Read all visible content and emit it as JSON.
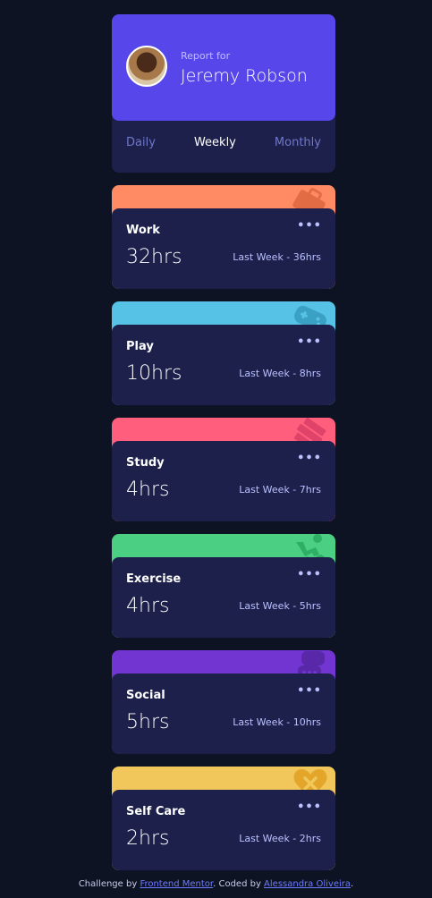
{
  "profile": {
    "report_for": "Report for",
    "name": "Jeremy Robson",
    "periods": [
      "Daily",
      "Weekly",
      "Monthly"
    ],
    "active_period": "Weekly"
  },
  "cards": [
    {
      "title": "Work",
      "hours": "32hrs",
      "last": "Last Week - 36hrs",
      "color": "#ff8b64",
      "icon": "briefcase-icon"
    },
    {
      "title": "Play",
      "hours": "10hrs",
      "last": "Last Week - 8hrs",
      "color": "#55c2e6",
      "icon": "gamepad-icon"
    },
    {
      "title": "Study",
      "hours": "4hrs",
      "last": "Last Week - 7hrs",
      "color": "#ff5e7d",
      "icon": "books-icon"
    },
    {
      "title": "Exercise",
      "hours": "4hrs",
      "last": "Last Week - 5hrs",
      "color": "#4bcf82",
      "icon": "runner-icon"
    },
    {
      "title": "Social",
      "hours": "5hrs",
      "last": "Last Week - 10hrs",
      "color": "#7335d2",
      "icon": "chat-bubbles-icon"
    },
    {
      "title": "Self Care",
      "hours": "2hrs",
      "last": "Last Week - 2hrs",
      "color": "#f1c75b",
      "icon": "heart-icon"
    }
  ],
  "menu_glyph": "•••",
  "footer": {
    "prefix": "Challenge by ",
    "link1": "Frontend Mentor",
    "middle": ". Coded by ",
    "link2": "Alessandra Oliveira",
    "suffix": "."
  }
}
